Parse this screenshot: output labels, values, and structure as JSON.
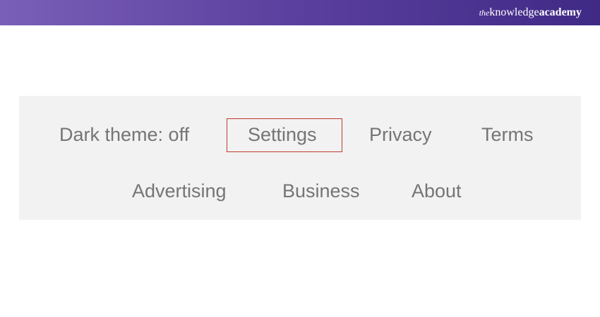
{
  "header": {
    "brand_prefix": "the",
    "brand_knowledge": "knowledge",
    "brand_academy": "academy",
    "gradient_colors": [
      "#7a5fb8",
      "#3f2a86"
    ]
  },
  "footer": {
    "row1": [
      {
        "label": "Dark theme: off"
      },
      {
        "label": "Settings",
        "highlighted": true
      },
      {
        "label": "Privacy"
      },
      {
        "label": "Terms"
      }
    ],
    "row2": [
      {
        "label": "Advertising"
      },
      {
        "label": "Business"
      },
      {
        "label": "About"
      }
    ],
    "highlight_color": "#c0392b",
    "panel_color": "#f2f2f2",
    "text_color": "#757575"
  }
}
